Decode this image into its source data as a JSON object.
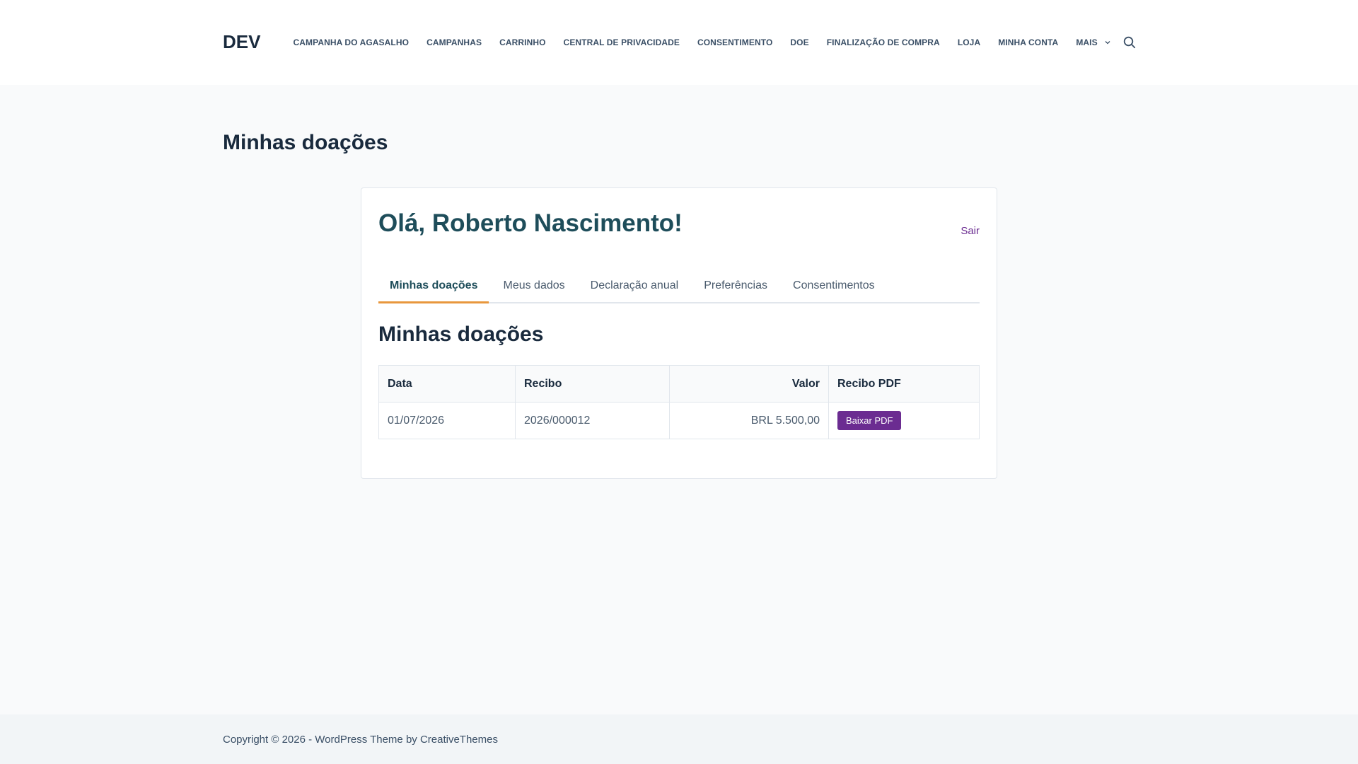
{
  "header": {
    "logo": "DEV",
    "nav": [
      "CAMPANHA DO AGASALHO",
      "CAMPANHAS",
      "CARRINHO",
      "CENTRAL DE PRIVACIDADE",
      "CONSENTIMENTO",
      "DOE",
      "FINALIZAÇÃO DE COMPRA",
      "LOJA",
      "MINHA CONTA"
    ],
    "more_label": "MAIS",
    "search_icon": "search-icon"
  },
  "page": {
    "title": "Minhas doações"
  },
  "account": {
    "greeting": "Olá, Roberto Nascimento!",
    "logout_label": "Sair",
    "tabs": [
      "Minhas doações",
      "Meus dados",
      "Declaração anual",
      "Preferências",
      "Consentimentos"
    ],
    "active_tab": "Minhas doações",
    "section_title": "Minhas doações",
    "table": {
      "headers": [
        "Data",
        "Recibo",
        "Valor",
        "Recibo PDF"
      ],
      "rows": [
        {
          "date": "01/07/2026",
          "receipt": "2026/000012",
          "amount": "BRL 5.500,00",
          "pdf_label": "Baixar PDF"
        }
      ]
    }
  },
  "footer": {
    "copyright": "Copyright © 2026 - WordPress Theme by CreativeThemes"
  },
  "colors": {
    "accent": "#6b2c91",
    "heading": "#1e4d5a",
    "tab_underline": "#e8973d"
  }
}
